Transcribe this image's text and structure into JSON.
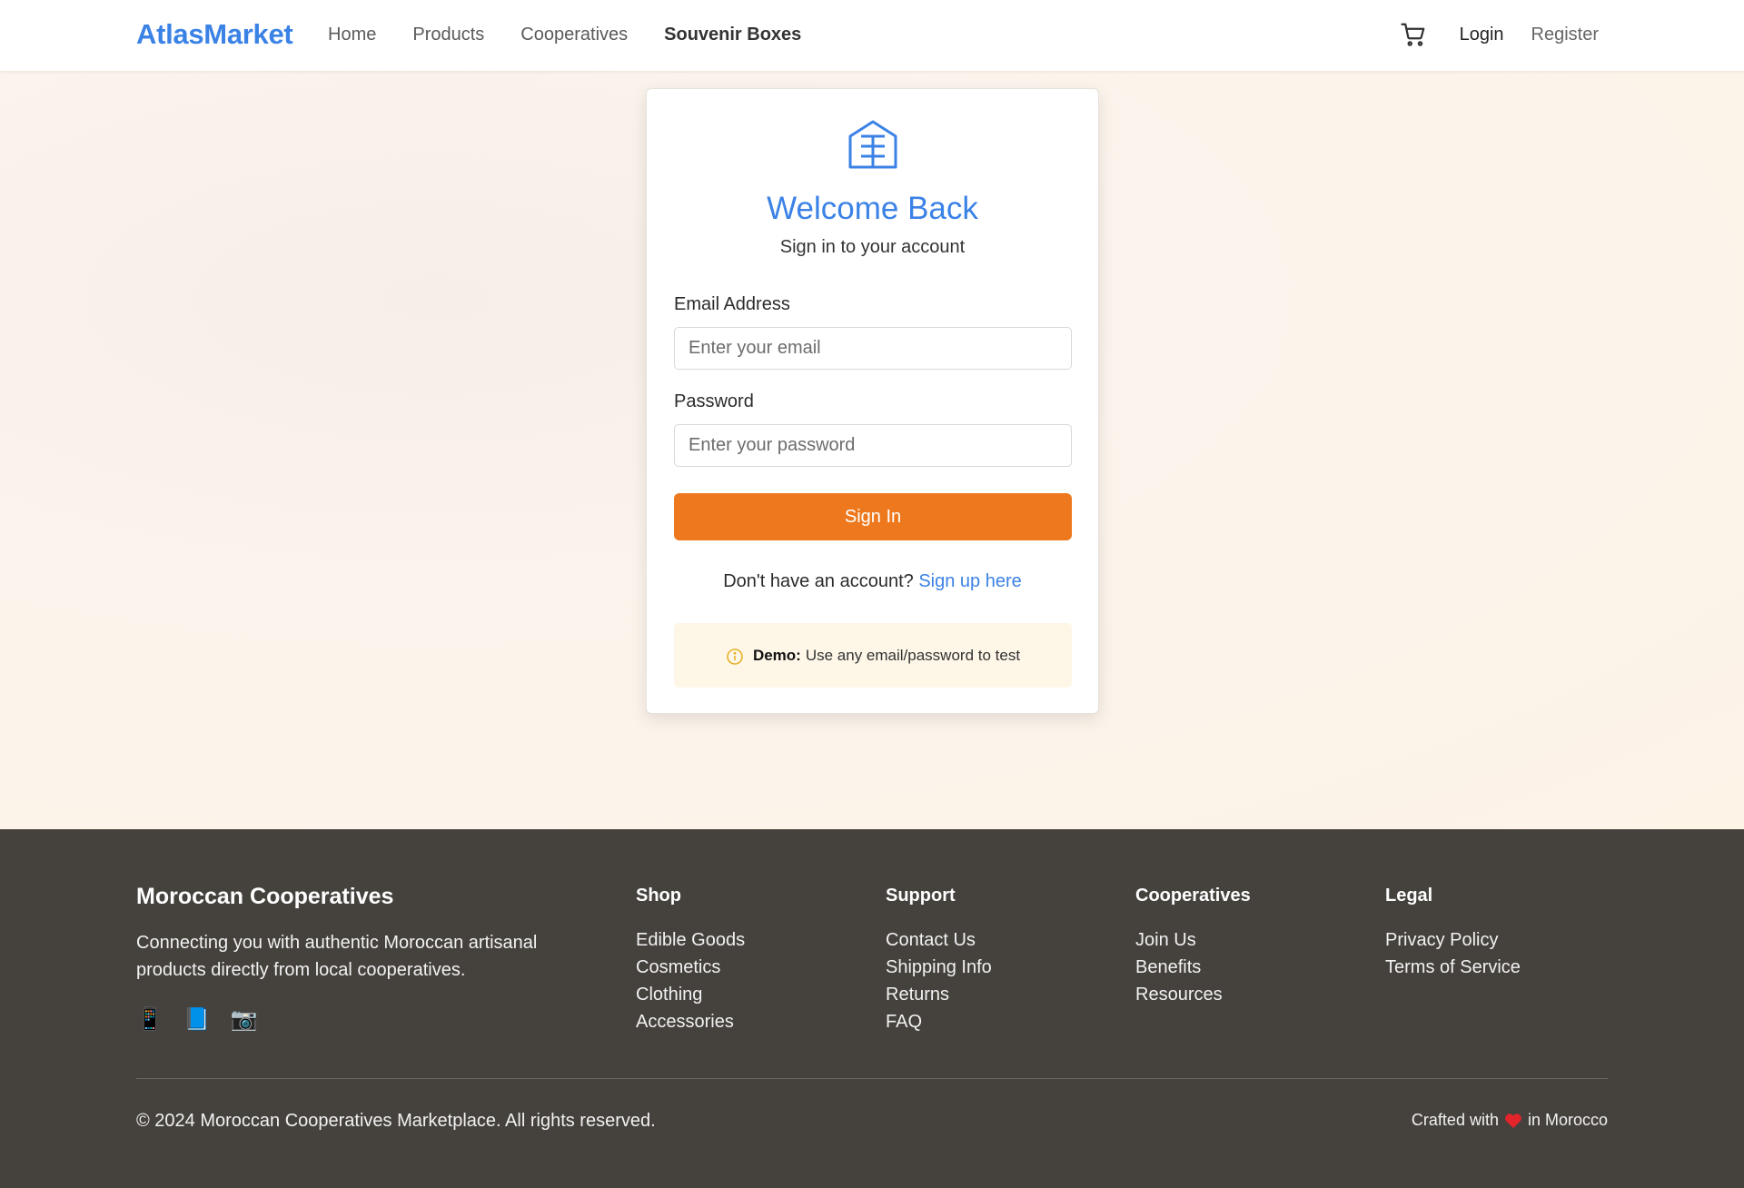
{
  "header": {
    "brand": "AtlasMarket",
    "nav": [
      "Home",
      "Products",
      "Cooperatives",
      "Souvenir Boxes"
    ],
    "cart_icon": "shopping-cart-icon",
    "login": "Login",
    "register": "Register"
  },
  "login_card": {
    "icon": "cooperative-building-icon",
    "title": "Welcome Back",
    "subtitle": "Sign in to your account",
    "email_label": "Email Address",
    "email_placeholder": "Enter your email",
    "email_value": "",
    "password_label": "Password",
    "password_placeholder": "Enter your password",
    "password_value": "",
    "submit": "Sign In",
    "signup_prompt": "Don't have an account?",
    "signup_link": "Sign up here",
    "demo_label": "Demo:",
    "demo_text": "Use any email/password to test",
    "demo_icon": "info-circle-icon"
  },
  "footer": {
    "brand": "Moroccan Cooperatives",
    "description": "Connecting you with authentic Moroccan artisanal products directly from local cooperatives.",
    "social": [
      "📱",
      "📘",
      "📷"
    ],
    "columns": [
      {
        "title": "Shop",
        "links": [
          "Edible Goods",
          "Cosmetics",
          "Clothing",
          "Accessories"
        ]
      },
      {
        "title": "Support",
        "links": [
          "Contact Us",
          "Shipping Info",
          "Returns",
          "FAQ"
        ]
      },
      {
        "title": "Cooperatives",
        "links": [
          "Join Us",
          "Benefits",
          "Resources"
        ]
      },
      {
        "title": "Legal",
        "links": [
          "Privacy Policy",
          "Terms of Service"
        ]
      }
    ],
    "copyright": "© 2024 Moroccan Cooperatives Marketplace. All rights reserved.",
    "crafted_prefix": "Crafted with",
    "crafted_suffix": "in Morocco"
  },
  "colors": {
    "brand_blue": "#3b82e6",
    "button_orange": "#ee781d",
    "footer_bg": "#45413d",
    "heart_red": "#e3242b"
  }
}
